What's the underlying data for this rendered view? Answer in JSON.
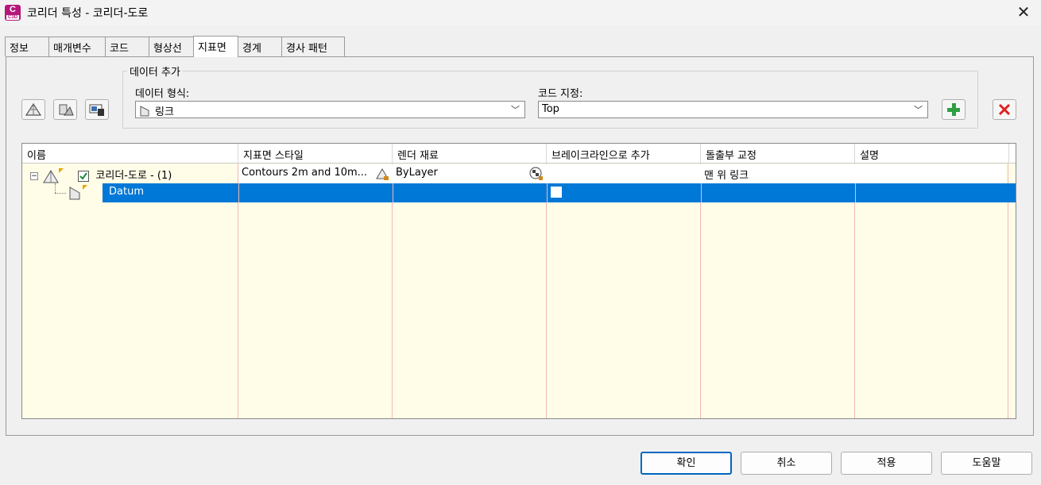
{
  "window": {
    "title": "코리더 특성 - 코리더-도로",
    "app_icon_letter": "C",
    "app_icon_sub": "C3D"
  },
  "tabs": [
    {
      "label": "정보"
    },
    {
      "label": "매개변수"
    },
    {
      "label": "코드"
    },
    {
      "label": "형상선"
    },
    {
      "label": "지표면",
      "active": true
    },
    {
      "label": "경계"
    },
    {
      "label": "경사 패턴"
    }
  ],
  "add_data": {
    "group_title": "데이터 추가",
    "data_type_label": "데이터 형식:",
    "data_type_value": "링크",
    "code_label": "코드 지정:",
    "code_value": "Top"
  },
  "grid": {
    "columns": [
      "이름",
      "지표면 스타일",
      "렌더 재료",
      "브레이크라인으로 추가",
      "돌출부 교정",
      "설명"
    ],
    "rows": [
      {
        "name": "코리더-도로 - (1)",
        "style": "Contours 2m and 10m...",
        "material": "ByLayer",
        "breakline": "",
        "overhang": "맨 위 링크",
        "description": ""
      },
      {
        "name": "Datum",
        "style": "",
        "material": "",
        "breakline": "",
        "overhang": "",
        "description": ""
      }
    ]
  },
  "buttons": {
    "ok": "확인",
    "cancel": "취소",
    "apply": "적용",
    "help": "도움말"
  },
  "colors": {
    "selection": "#0078d7",
    "grid_bg": "#fffde8",
    "add_green": "#2ea043",
    "remove_red": "#e02020"
  }
}
